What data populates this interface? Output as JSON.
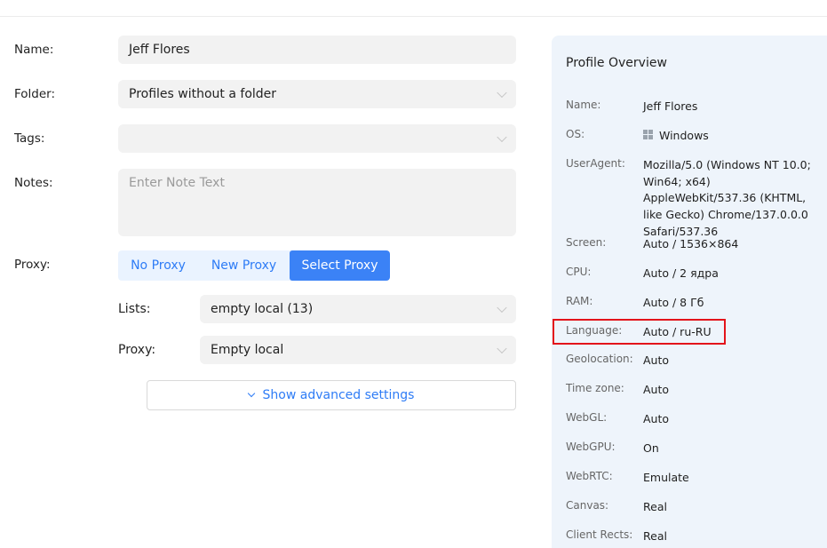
{
  "form": {
    "name_label": "Name:",
    "name_value": "Jeff Flores",
    "folder_label": "Folder:",
    "folder_value": "Profiles without a folder",
    "tags_label": "Tags:",
    "tags_value": "",
    "notes_label": "Notes:",
    "notes_placeholder": "Enter Note Text",
    "proxy_label": "Proxy:",
    "proxy_tabs": [
      "No Proxy",
      "New Proxy",
      "Select Proxy"
    ],
    "proxy_active_tab": "Select Proxy",
    "lists_label": "Lists:",
    "lists_value": "empty local (13)",
    "proxy_sub_label": "Proxy:",
    "proxy_sub_value": "Empty local",
    "advanced_label": "Show advanced settings"
  },
  "overview": {
    "title": "Profile Overview",
    "rows": [
      {
        "key": "Name:",
        "value": "Jeff Flores"
      },
      {
        "key": "OS:",
        "value": "Windows",
        "icon": "windows-icon"
      },
      {
        "key": "UserAgent:",
        "value": "Mozilla/5.0 (Windows NT 10.0; Win64; x64) AppleWebKit/537.36 (KHTML, like Gecko) Chrome/137.0.0.0 Safari/537.36"
      },
      {
        "key": "Screen:",
        "value": "Auto / 1536×864"
      },
      {
        "key": "CPU:",
        "value": "Auto / 2 ядра"
      },
      {
        "key": "RAM:",
        "value": "Auto / 8 Гб"
      },
      {
        "key": "Language:",
        "value": "Auto / ru-RU"
      },
      {
        "key": "Geolocation:",
        "value": "Auto"
      },
      {
        "key": "Time zone:",
        "value": "Auto"
      },
      {
        "key": "WebGL:",
        "value": "Auto"
      },
      {
        "key": "WebGPU:",
        "value": "On"
      },
      {
        "key": "WebRTC:",
        "value": "Emulate"
      },
      {
        "key": "Canvas:",
        "value": "Real"
      },
      {
        "key": "Client Rects:",
        "value": "Real"
      }
    ]
  },
  "colors": {
    "accent": "#3b82f6",
    "panel_bg": "#eef4fb",
    "highlight": "#e3141b"
  }
}
